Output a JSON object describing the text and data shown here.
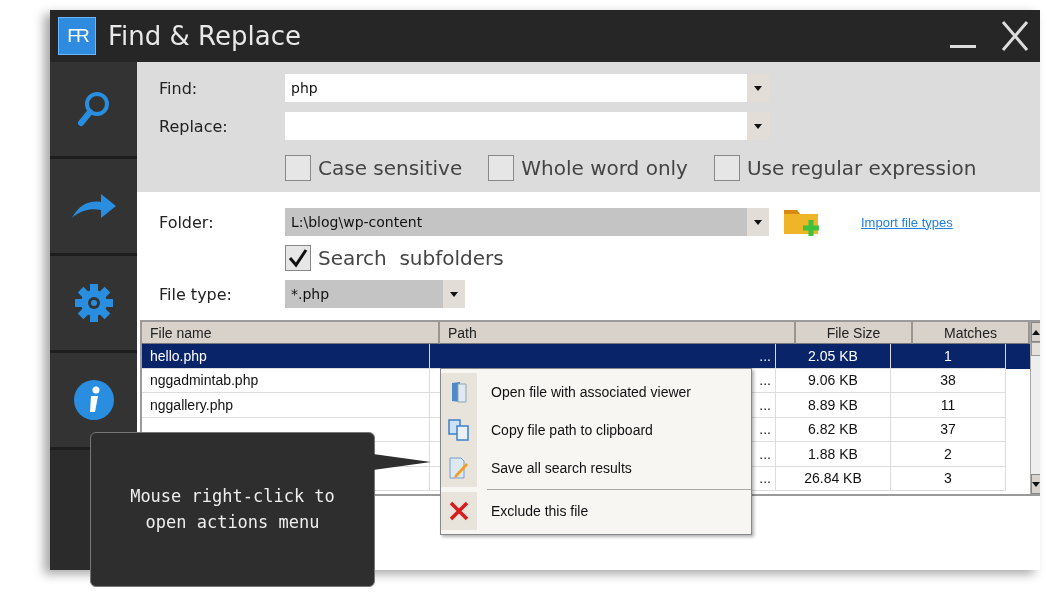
{
  "window": {
    "title": "Find & Replace",
    "logo": "FR"
  },
  "sidebar": {
    "items": [
      {
        "kind": "search"
      },
      {
        "kind": "replace"
      },
      {
        "kind": "settings"
      },
      {
        "kind": "info"
      }
    ]
  },
  "find": {
    "label": "Find:",
    "value": "php"
  },
  "replace": {
    "label": "Replace:"
  },
  "options": [
    {
      "label": "Case sensitive",
      "checked": false
    },
    {
      "label": "Whole word only",
      "checked": false
    },
    {
      "label": "Use regular expression",
      "checked": false
    }
  ],
  "folder": {
    "label": "Folder:",
    "value": "L:\\blog\\wp-content",
    "link": "Import file types"
  },
  "subfolders": {
    "label": "Search  subfolders",
    "checked": true
  },
  "file_type": {
    "label": "File type:",
    "value": "*.php"
  },
  "table": {
    "columns": [
      "File name",
      "Path",
      "File Size",
      "Matches"
    ],
    "rows": [
      {
        "name": "hello.php",
        "path": "...",
        "size": "2.05 KB",
        "matches": "1",
        "selected": true
      },
      {
        "name": "nggadmintab.php",
        "path": "...",
        "size": "9.06 KB",
        "matches": "38",
        "selected": false
      },
      {
        "name": "nggallery.php",
        "path": "...",
        "size": "8.89 KB",
        "matches": "11",
        "selected": false
      },
      {
        "path": "...",
        "size": "6.82 KB",
        "matches": "37",
        "selected": false
      },
      {
        "path": "...",
        "size": "1.88 KB",
        "matches": "2",
        "selected": false
      },
      {
        "path": "...",
        "size": "26.84 KB",
        "matches": "3",
        "selected": false
      }
    ]
  },
  "context_menu": [
    {
      "kind": "open",
      "label": "Open file with associated viewer"
    },
    {
      "kind": "copy",
      "label": "Copy file path to clipboard"
    },
    {
      "kind": "save",
      "label": "Save all search results"
    },
    {
      "kind": "exclude",
      "label": "Exclude this file"
    }
  ],
  "tooltip": "Mouse right-click to open actions menu"
}
